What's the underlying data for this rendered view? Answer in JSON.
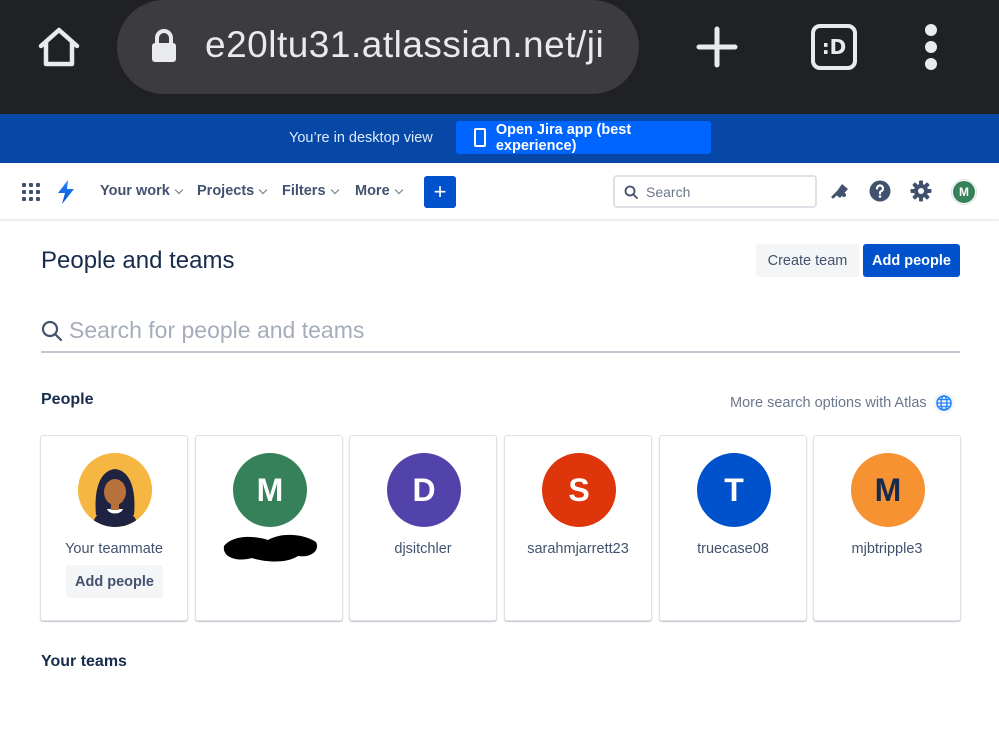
{
  "browser": {
    "url": "e20ltu31.atlassian.net/ji",
    "tabs_label": ":D"
  },
  "banner": {
    "message": "You’re in desktop view",
    "open_app_label": "Open Jira app (best experience)"
  },
  "nav": {
    "menus": [
      {
        "label": "Your work"
      },
      {
        "label": "Projects"
      },
      {
        "label": "Filters"
      },
      {
        "label": "More"
      }
    ],
    "create_label": "+",
    "search_placeholder": "Search",
    "user_initial": "M",
    "user_color": "#36805a"
  },
  "page": {
    "title": "People and teams",
    "create_team_label": "Create team",
    "add_people_label": "Add people",
    "search_placeholder": "Search for people and teams"
  },
  "people": {
    "heading": "People",
    "atlas_link": "More search options with Atlas",
    "cards": [
      {
        "type": "teammate",
        "name": "Your teammate",
        "button": "Add people"
      },
      {
        "initial": "M",
        "name": "",
        "color": "#36805a",
        "redacted": true
      },
      {
        "initial": "D",
        "name": "djsitchler",
        "color": "#5243aa"
      },
      {
        "initial": "S",
        "name": "sarahmjarrett23",
        "color": "#de350b"
      },
      {
        "initial": "T",
        "name": "truecase08",
        "color": "#0052cc"
      },
      {
        "initial": "M",
        "name": "mjbtripple3",
        "color": "#f79233",
        "text_color": "#172b4d"
      }
    ]
  },
  "teams": {
    "heading": "Your teams"
  }
}
